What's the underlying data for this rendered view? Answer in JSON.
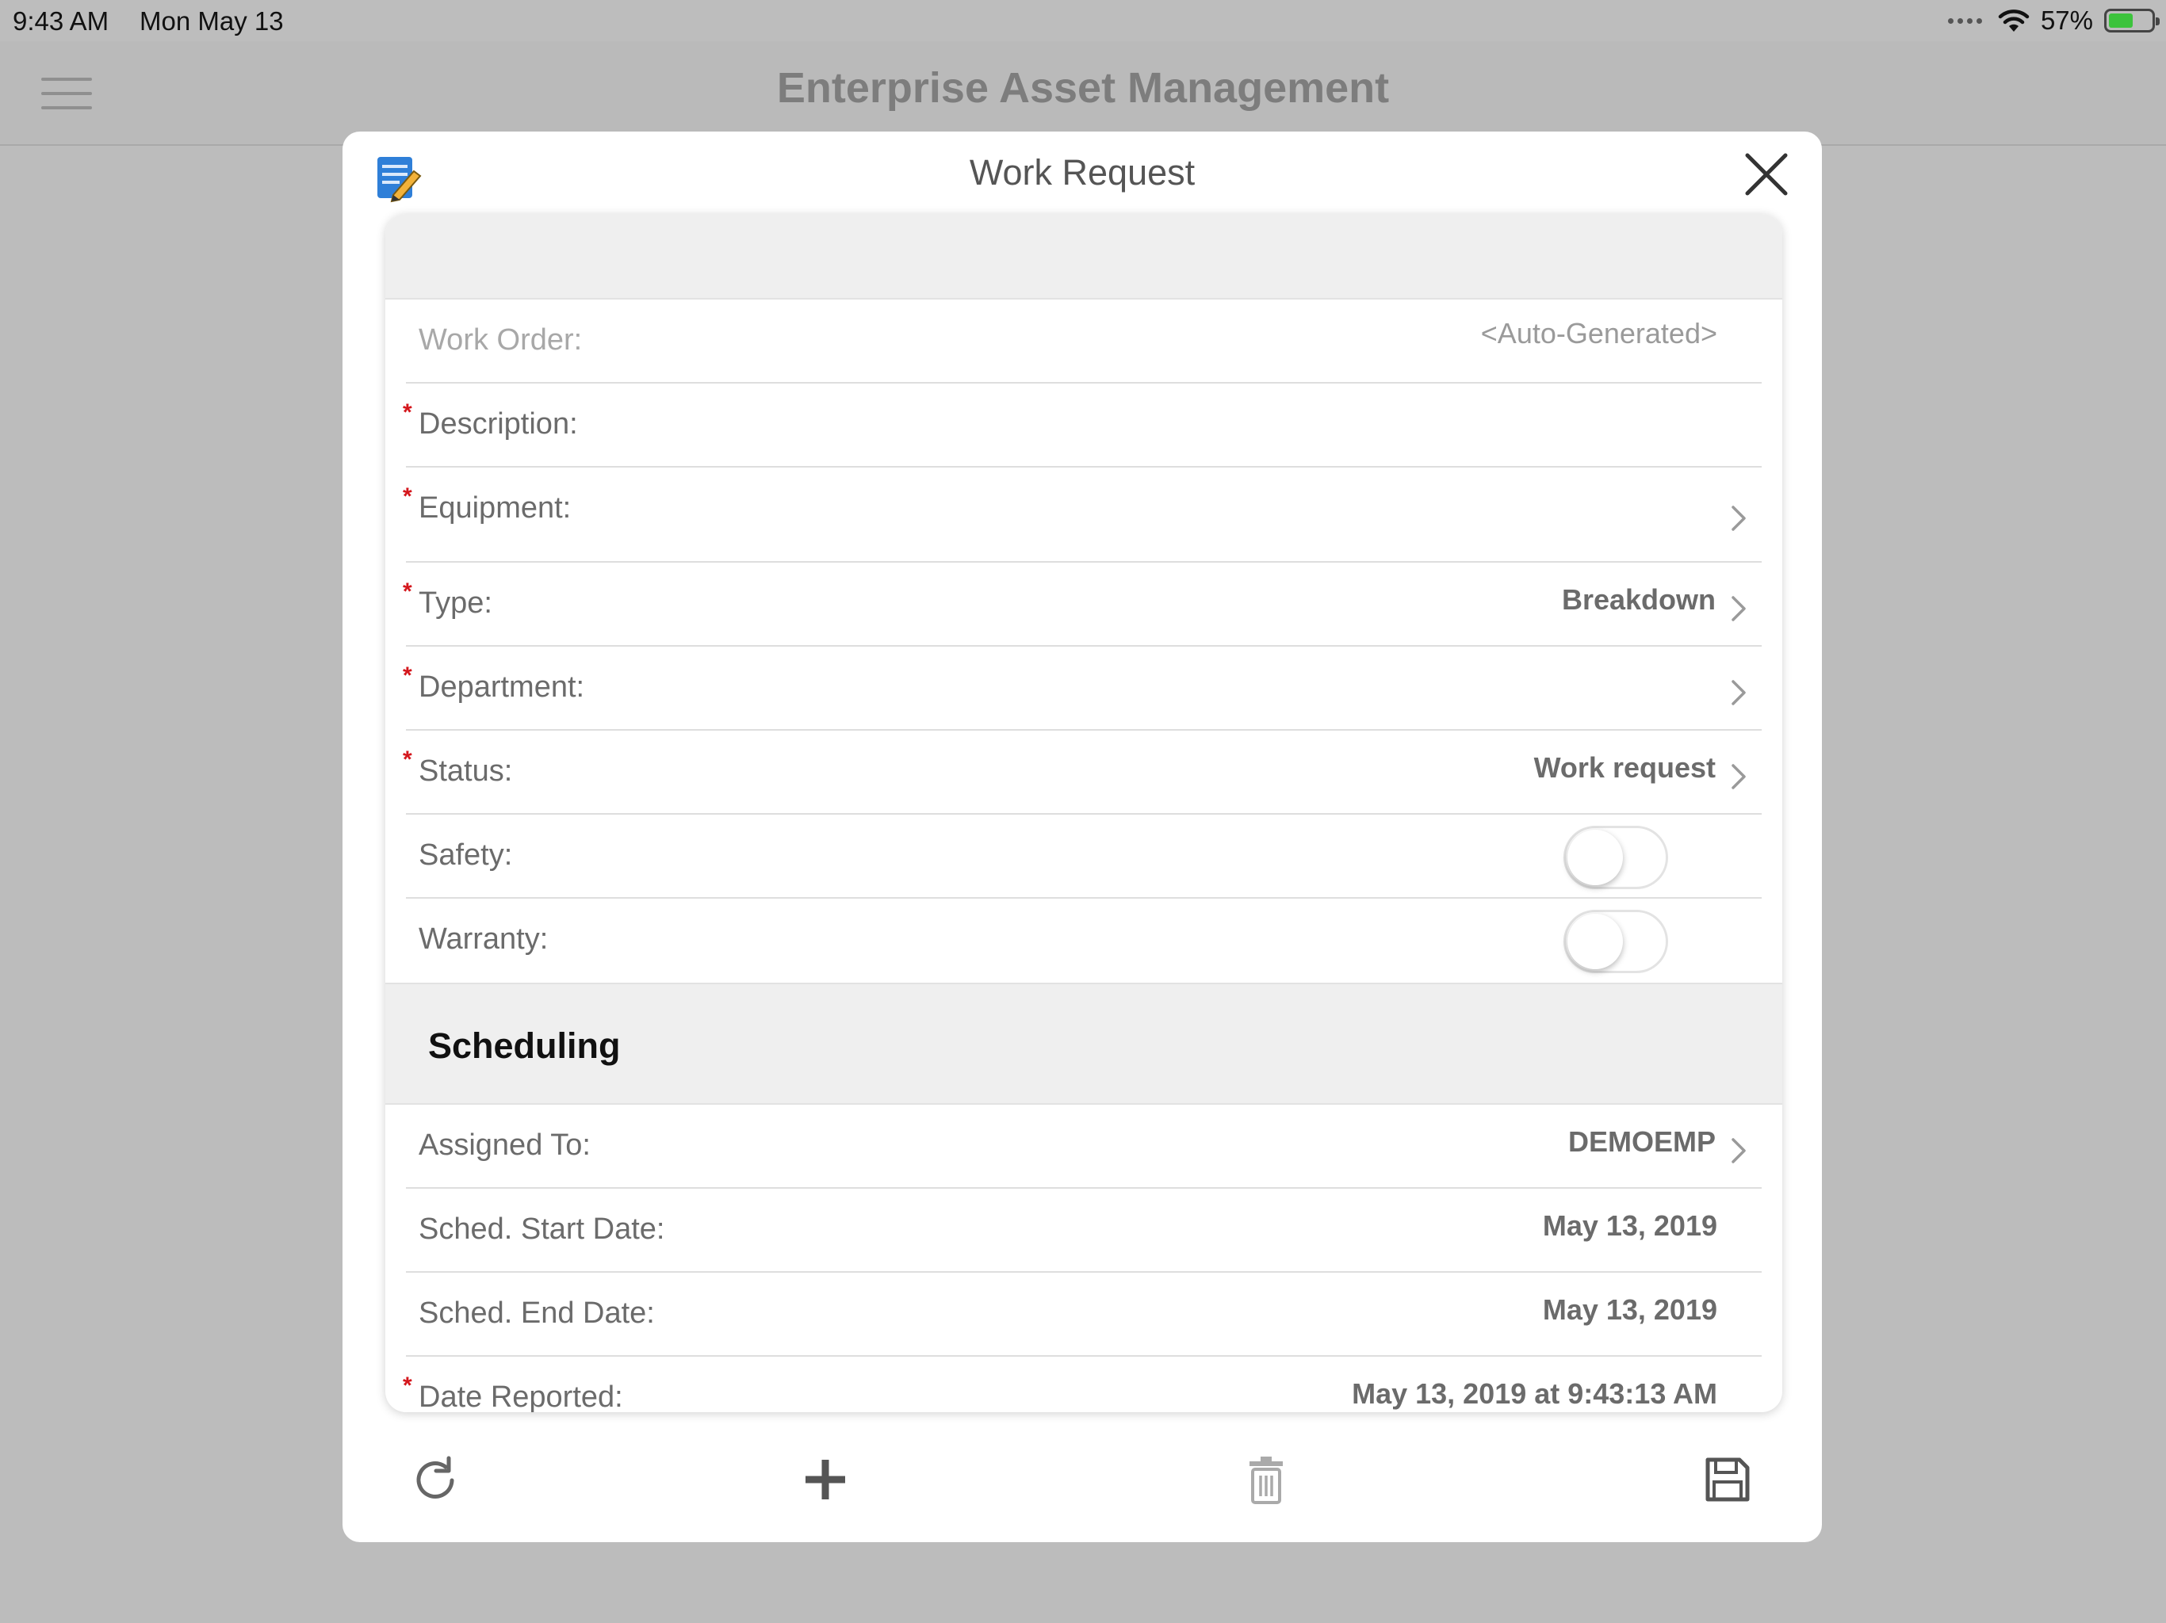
{
  "status_bar": {
    "time": "9:43 AM",
    "date": "Mon May 13",
    "battery": "57%",
    "battery_level": 0.57
  },
  "app": {
    "title": "Enterprise Asset Management"
  },
  "modal": {
    "title": "Work Request"
  },
  "form": {
    "required_marker": "*",
    "work_order": {
      "label": "Work Order:",
      "value": "<Auto-Generated>"
    },
    "description": {
      "label": "Description:",
      "value": ""
    },
    "equipment": {
      "label": "Equipment:",
      "value": ""
    },
    "type": {
      "label": "Type:",
      "value": "Breakdown"
    },
    "department": {
      "label": "Department:",
      "value": ""
    },
    "status": {
      "label": "Status:",
      "value": "Work request"
    },
    "safety": {
      "label": "Safety:",
      "on": false
    },
    "warranty": {
      "label": "Warranty:",
      "on": false
    }
  },
  "scheduling": {
    "title": "Scheduling",
    "assigned_to": {
      "label": "Assigned To:",
      "value": "DEMOEMP"
    },
    "sched_start": {
      "label": "Sched. Start Date:",
      "value": "May 13, 2019"
    },
    "sched_end": {
      "label": "Sched. End Date:",
      "value": "May 13, 2019"
    },
    "date_reported": {
      "label": "Date Reported:",
      "value": "May 13, 2019 at 9:43:13 AM"
    }
  },
  "colors": {
    "accent_blue": "#2f7fd8",
    "required_red": "#d4161c",
    "battery_green": "#3cc33c"
  },
  "icons": {
    "edit": "edit-document-icon",
    "close": "close-icon",
    "chevron": "chevron-right-icon",
    "refresh": "refresh-icon",
    "add": "plus-icon",
    "delete": "trash-icon",
    "save": "save-icon"
  }
}
